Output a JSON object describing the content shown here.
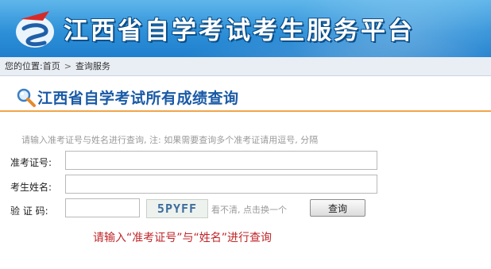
{
  "header": {
    "title": "江西省自学考试考生服务平台"
  },
  "breadcrumb": {
    "prefix": "您的位置:",
    "home": "首页",
    "separator": ">",
    "current": "查询服务"
  },
  "page": {
    "title": "江西省自学考试所有成绩查询"
  },
  "form": {
    "hint": "请输入准考证号与姓名进行查询, 注: 如果需要查询多个准考证请用逗号, 分隔",
    "ticket_label": "准考证号:",
    "ticket_value": "",
    "name_label": "考生姓名:",
    "name_value": "",
    "code_label": "验 证 码:",
    "code_value": "",
    "captcha_text": "5PYFF",
    "captcha_tip": "看不清, 点击换一个",
    "submit_label": "查询",
    "message": "请输入“准考证号”与“姓名”进行查询"
  },
  "colors": {
    "banner": "#2e90d8",
    "title_blue": "#1a5aa6",
    "accent_orange": "#f0a64a",
    "error_red": "#c0262a"
  }
}
